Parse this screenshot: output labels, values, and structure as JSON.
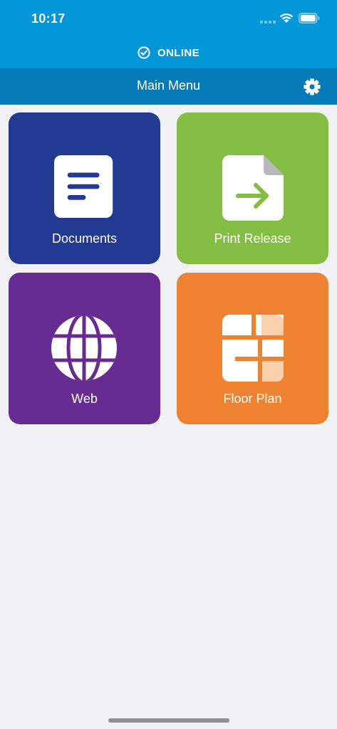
{
  "status_bar": {
    "time": "10:17"
  },
  "connection": {
    "status_label": "ONLINE"
  },
  "header": {
    "title": "Main Menu"
  },
  "menu": {
    "tiles": [
      {
        "label": "Documents",
        "icon": "document-icon",
        "color": "#233a92"
      },
      {
        "label": "Print Release",
        "icon": "print-release-icon",
        "color": "#83bd43"
      },
      {
        "label": "Web",
        "icon": "globe-icon",
        "color": "#672c91"
      },
      {
        "label": "Floor Plan",
        "icon": "floor-plan-icon",
        "color": "#ef8230"
      }
    ]
  },
  "colors": {
    "status_bar": "#0396d8",
    "header": "#047ab7",
    "background": "#f2f2f6"
  }
}
